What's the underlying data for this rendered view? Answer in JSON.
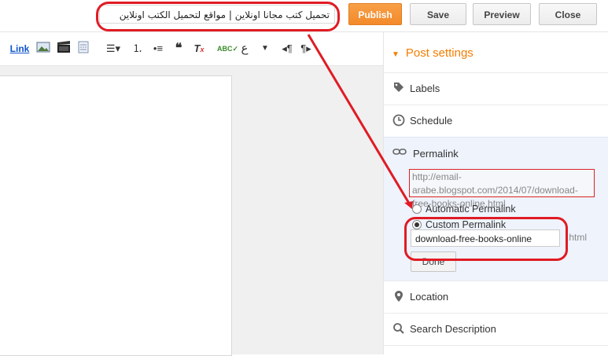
{
  "topbar": {
    "post_title": "تحميل كتب مجانا اونلاين | مواقع لتحميل الكتب اونلاين",
    "publish_label": "Publish",
    "save_label": "Save",
    "preview_label": "Preview",
    "close_label": "Close"
  },
  "toolbar": {
    "link_label": "Link",
    "icons": [
      "image-icon",
      "video-icon",
      "jump-break-icon",
      "align-icon",
      "numbered-list-icon",
      "bullet-list-icon",
      "quote-icon",
      "remove-format-icon",
      "spellcheck-icon",
      "arabic-input-icon",
      "rtl-icon",
      "ltr-icon"
    ]
  },
  "sidebar": {
    "header": "Post settings",
    "labels": "Labels",
    "schedule": "Schedule",
    "permalink": "Permalink",
    "permalink_url": "http://email-arabe.blogspot.com/2014/07/download-free-books-online.html",
    "automatic_permalink": "Automatic Permalink",
    "custom_permalink": "Custom Permalink",
    "custom_value": "download-free-books-online",
    "html_suffix": ".html",
    "done_label": "Done",
    "location": "Location",
    "search_description": "Search Description"
  },
  "colors": {
    "accent": "#f57d00",
    "publish": "#f38a2a",
    "annotation": "#e01b24"
  }
}
